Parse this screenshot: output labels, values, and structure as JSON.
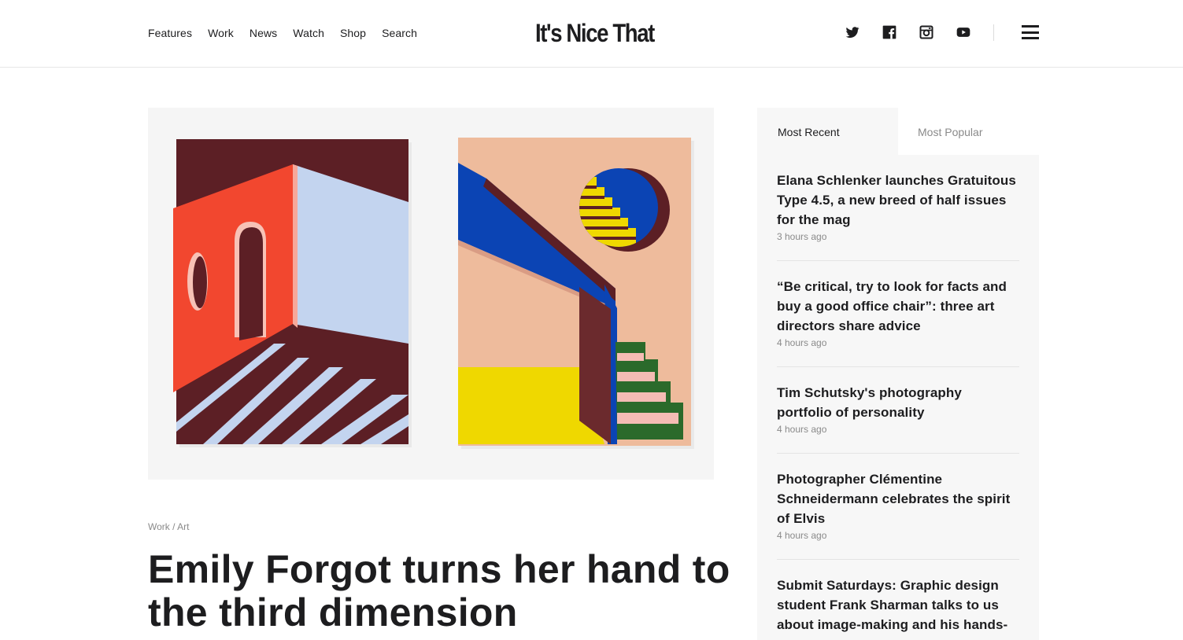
{
  "header": {
    "nav": [
      "Features",
      "Work",
      "News",
      "Watch",
      "Shop",
      "Search"
    ],
    "logo": "It's Nice That",
    "social_icons": [
      "twitter-icon",
      "facebook-icon",
      "instagram-icon",
      "youtube-icon"
    ],
    "menu_icon": "hamburger-menu-icon"
  },
  "article": {
    "breadcrumb": [
      "Work",
      "Art"
    ],
    "breadcrumb_separator": "/",
    "headline": "Emily Forgot turns her hand to the third dimension"
  },
  "sidebar": {
    "tabs": [
      "Most Recent",
      "Most Popular"
    ],
    "active_tab": "Most Recent",
    "items": [
      {
        "title": "Elana Schlenker launches Gratuitous Type 4.5, a new breed of half issues for the mag",
        "time": "3 hours ago"
      },
      {
        "title": "“Be critical, try to look for facts and buy a good office chair”: three art directors share advice",
        "time": "4 hours ago"
      },
      {
        "title": "Tim Schutsky's photography portfolio of personality",
        "time": "4 hours ago"
      },
      {
        "title": "Photographer Clémentine Schneidermann celebrates the spirit of Elvis",
        "time": "4 hours ago"
      },
      {
        "title": "Submit Saturdays: Graphic design student Frank Sharman talks to us about image-making and his hands-",
        "time": ""
      }
    ]
  },
  "colors": {
    "text": "#1d1d1f",
    "muted": "#8a8a8a",
    "sidebar_bg": "#f7f7f7",
    "art_maroon": "#5c1f25",
    "art_red": "#f2472f",
    "art_lightblue": "#c3d4ef",
    "art_peach": "#eebb9c",
    "art_blue": "#0b44b4",
    "art_yellow": "#efd800",
    "art_green": "#2b6a2b"
  }
}
